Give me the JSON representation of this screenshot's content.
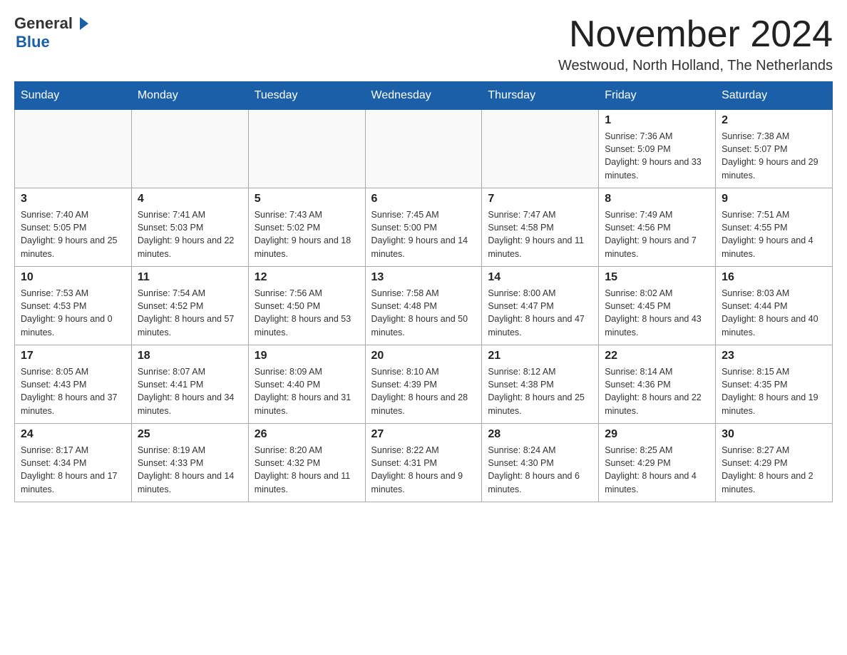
{
  "header": {
    "logo_general": "General",
    "logo_blue": "Blue",
    "month_title": "November 2024",
    "subtitle": "Westwoud, North Holland, The Netherlands"
  },
  "weekdays": [
    "Sunday",
    "Monday",
    "Tuesday",
    "Wednesday",
    "Thursday",
    "Friday",
    "Saturday"
  ],
  "weeks": [
    [
      {
        "day": "",
        "info": ""
      },
      {
        "day": "",
        "info": ""
      },
      {
        "day": "",
        "info": ""
      },
      {
        "day": "",
        "info": ""
      },
      {
        "day": "",
        "info": ""
      },
      {
        "day": "1",
        "info": "Sunrise: 7:36 AM\nSunset: 5:09 PM\nDaylight: 9 hours and 33 minutes."
      },
      {
        "day": "2",
        "info": "Sunrise: 7:38 AM\nSunset: 5:07 PM\nDaylight: 9 hours and 29 minutes."
      }
    ],
    [
      {
        "day": "3",
        "info": "Sunrise: 7:40 AM\nSunset: 5:05 PM\nDaylight: 9 hours and 25 minutes."
      },
      {
        "day": "4",
        "info": "Sunrise: 7:41 AM\nSunset: 5:03 PM\nDaylight: 9 hours and 22 minutes."
      },
      {
        "day": "5",
        "info": "Sunrise: 7:43 AM\nSunset: 5:02 PM\nDaylight: 9 hours and 18 minutes."
      },
      {
        "day": "6",
        "info": "Sunrise: 7:45 AM\nSunset: 5:00 PM\nDaylight: 9 hours and 14 minutes."
      },
      {
        "day": "7",
        "info": "Sunrise: 7:47 AM\nSunset: 4:58 PM\nDaylight: 9 hours and 11 minutes."
      },
      {
        "day": "8",
        "info": "Sunrise: 7:49 AM\nSunset: 4:56 PM\nDaylight: 9 hours and 7 minutes."
      },
      {
        "day": "9",
        "info": "Sunrise: 7:51 AM\nSunset: 4:55 PM\nDaylight: 9 hours and 4 minutes."
      }
    ],
    [
      {
        "day": "10",
        "info": "Sunrise: 7:53 AM\nSunset: 4:53 PM\nDaylight: 9 hours and 0 minutes."
      },
      {
        "day": "11",
        "info": "Sunrise: 7:54 AM\nSunset: 4:52 PM\nDaylight: 8 hours and 57 minutes."
      },
      {
        "day": "12",
        "info": "Sunrise: 7:56 AM\nSunset: 4:50 PM\nDaylight: 8 hours and 53 minutes."
      },
      {
        "day": "13",
        "info": "Sunrise: 7:58 AM\nSunset: 4:48 PM\nDaylight: 8 hours and 50 minutes."
      },
      {
        "day": "14",
        "info": "Sunrise: 8:00 AM\nSunset: 4:47 PM\nDaylight: 8 hours and 47 minutes."
      },
      {
        "day": "15",
        "info": "Sunrise: 8:02 AM\nSunset: 4:45 PM\nDaylight: 8 hours and 43 minutes."
      },
      {
        "day": "16",
        "info": "Sunrise: 8:03 AM\nSunset: 4:44 PM\nDaylight: 8 hours and 40 minutes."
      }
    ],
    [
      {
        "day": "17",
        "info": "Sunrise: 8:05 AM\nSunset: 4:43 PM\nDaylight: 8 hours and 37 minutes."
      },
      {
        "day": "18",
        "info": "Sunrise: 8:07 AM\nSunset: 4:41 PM\nDaylight: 8 hours and 34 minutes."
      },
      {
        "day": "19",
        "info": "Sunrise: 8:09 AM\nSunset: 4:40 PM\nDaylight: 8 hours and 31 minutes."
      },
      {
        "day": "20",
        "info": "Sunrise: 8:10 AM\nSunset: 4:39 PM\nDaylight: 8 hours and 28 minutes."
      },
      {
        "day": "21",
        "info": "Sunrise: 8:12 AM\nSunset: 4:38 PM\nDaylight: 8 hours and 25 minutes."
      },
      {
        "day": "22",
        "info": "Sunrise: 8:14 AM\nSunset: 4:36 PM\nDaylight: 8 hours and 22 minutes."
      },
      {
        "day": "23",
        "info": "Sunrise: 8:15 AM\nSunset: 4:35 PM\nDaylight: 8 hours and 19 minutes."
      }
    ],
    [
      {
        "day": "24",
        "info": "Sunrise: 8:17 AM\nSunset: 4:34 PM\nDaylight: 8 hours and 17 minutes."
      },
      {
        "day": "25",
        "info": "Sunrise: 8:19 AM\nSunset: 4:33 PM\nDaylight: 8 hours and 14 minutes."
      },
      {
        "day": "26",
        "info": "Sunrise: 8:20 AM\nSunset: 4:32 PM\nDaylight: 8 hours and 11 minutes."
      },
      {
        "day": "27",
        "info": "Sunrise: 8:22 AM\nSunset: 4:31 PM\nDaylight: 8 hours and 9 minutes."
      },
      {
        "day": "28",
        "info": "Sunrise: 8:24 AM\nSunset: 4:30 PM\nDaylight: 8 hours and 6 minutes."
      },
      {
        "day": "29",
        "info": "Sunrise: 8:25 AM\nSunset: 4:29 PM\nDaylight: 8 hours and 4 minutes."
      },
      {
        "day": "30",
        "info": "Sunrise: 8:27 AM\nSunset: 4:29 PM\nDaylight: 8 hours and 2 minutes."
      }
    ]
  ]
}
